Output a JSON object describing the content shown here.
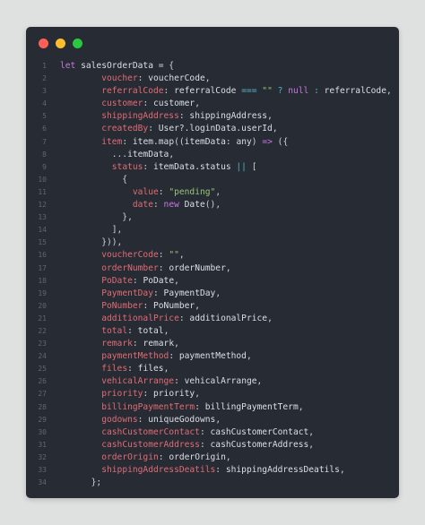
{
  "window": {
    "buttons": [
      {
        "name": "close",
        "color": "#ff5f57"
      },
      {
        "name": "minimize",
        "color": "#febc2e"
      },
      {
        "name": "maximize",
        "color": "#28c840"
      }
    ]
  },
  "code": {
    "lines": [
      {
        "n": "1",
        "t": [
          [
            "kw",
            "let "
          ],
          [
            "id",
            "salesOrderData"
          ],
          [
            "pun",
            " = {"
          ]
        ]
      },
      {
        "n": "2",
        "t": [
          [
            "pun",
            "        "
          ],
          [
            "prop",
            "voucher"
          ],
          [
            "pun",
            ": "
          ],
          [
            "id",
            "voucherCode"
          ],
          [
            "pun",
            ","
          ]
        ]
      },
      {
        "n": "3",
        "t": [
          [
            "pun",
            "        "
          ],
          [
            "prop",
            "referralCode"
          ],
          [
            "pun",
            ": "
          ],
          [
            "id",
            "referralCode "
          ],
          [
            "op",
            "==="
          ],
          [
            "pun",
            " "
          ],
          [
            "str",
            "\"\""
          ],
          [
            "pun",
            " "
          ],
          [
            "op",
            "?"
          ],
          [
            "pun",
            " "
          ],
          [
            "kw",
            "null"
          ],
          [
            "pun",
            " "
          ],
          [
            "op",
            ":"
          ],
          [
            "pun",
            " "
          ],
          [
            "id",
            "referralCode"
          ],
          [
            "pun",
            ","
          ]
        ]
      },
      {
        "n": "4",
        "t": [
          [
            "pun",
            "        "
          ],
          [
            "prop",
            "customer"
          ],
          [
            "pun",
            ": "
          ],
          [
            "id",
            "customer"
          ],
          [
            "pun",
            ","
          ]
        ]
      },
      {
        "n": "5",
        "t": [
          [
            "pun",
            "        "
          ],
          [
            "prop",
            "shippingAddress"
          ],
          [
            "pun",
            ": "
          ],
          [
            "id",
            "shippingAddress"
          ],
          [
            "pun",
            ","
          ]
        ]
      },
      {
        "n": "6",
        "t": [
          [
            "pun",
            "        "
          ],
          [
            "prop",
            "createdBy"
          ],
          [
            "pun",
            ": "
          ],
          [
            "id",
            "User?.loginData.userId"
          ],
          [
            "pun",
            ","
          ]
        ]
      },
      {
        "n": "7",
        "t": [
          [
            "pun",
            "        "
          ],
          [
            "prop",
            "item"
          ],
          [
            "pun",
            ": "
          ],
          [
            "id",
            "item.map"
          ],
          [
            "pun",
            "(("
          ],
          [
            "id",
            "itemData"
          ],
          [
            "pun",
            ": "
          ],
          [
            "id",
            "any"
          ],
          [
            "pun",
            ") "
          ],
          [
            "kw",
            "=>"
          ],
          [
            "pun",
            " ({"
          ]
        ]
      },
      {
        "n": "8",
        "t": [
          [
            "pun",
            "          ..."
          ],
          [
            "id",
            "itemData"
          ],
          [
            "pun",
            ","
          ]
        ]
      },
      {
        "n": "9",
        "t": [
          [
            "pun",
            "          "
          ],
          [
            "prop",
            "status"
          ],
          [
            "pun",
            ": "
          ],
          [
            "id",
            "itemData.status "
          ],
          [
            "op",
            "||"
          ],
          [
            "pun",
            " ["
          ]
        ]
      },
      {
        "n": "10",
        "t": [
          [
            "pun",
            "            {"
          ]
        ]
      },
      {
        "n": "11",
        "t": [
          [
            "pun",
            "              "
          ],
          [
            "prop",
            "value"
          ],
          [
            "pun",
            ": "
          ],
          [
            "str",
            "\"pending\""
          ],
          [
            "pun",
            ","
          ]
        ]
      },
      {
        "n": "12",
        "t": [
          [
            "pun",
            "              "
          ],
          [
            "prop",
            "date"
          ],
          [
            "pun",
            ": "
          ],
          [
            "kw",
            "new "
          ],
          [
            "id",
            "Date"
          ],
          [
            "pun",
            "(),"
          ]
        ]
      },
      {
        "n": "13",
        "t": [
          [
            "pun",
            "            },"
          ]
        ]
      },
      {
        "n": "14",
        "t": [
          [
            "pun",
            "          ],"
          ]
        ]
      },
      {
        "n": "15",
        "t": [
          [
            "pun",
            "        })),"
          ]
        ]
      },
      {
        "n": "16",
        "t": [
          [
            "pun",
            "        "
          ],
          [
            "prop",
            "voucherCode"
          ],
          [
            "pun",
            ": "
          ],
          [
            "str",
            "\"\""
          ],
          [
            "pun",
            ","
          ]
        ]
      },
      {
        "n": "17",
        "t": [
          [
            "pun",
            "        "
          ],
          [
            "prop",
            "orderNumber"
          ],
          [
            "pun",
            ": "
          ],
          [
            "id",
            "orderNumber"
          ],
          [
            "pun",
            ","
          ]
        ]
      },
      {
        "n": "18",
        "t": [
          [
            "pun",
            "        "
          ],
          [
            "prop",
            "PoDate"
          ],
          [
            "pun",
            ": "
          ],
          [
            "id",
            "PoDate"
          ],
          [
            "pun",
            ","
          ]
        ]
      },
      {
        "n": "19",
        "t": [
          [
            "pun",
            "        "
          ],
          [
            "prop",
            "PaymentDay"
          ],
          [
            "pun",
            ": "
          ],
          [
            "id",
            "PaymentDay"
          ],
          [
            "pun",
            ","
          ]
        ]
      },
      {
        "n": "20",
        "t": [
          [
            "pun",
            "        "
          ],
          [
            "prop",
            "PoNumber"
          ],
          [
            "pun",
            ": "
          ],
          [
            "id",
            "PoNumber"
          ],
          [
            "pun",
            ","
          ]
        ]
      },
      {
        "n": "21",
        "t": [
          [
            "pun",
            "        "
          ],
          [
            "prop",
            "additionalPrice"
          ],
          [
            "pun",
            ": "
          ],
          [
            "id",
            "additionalPrice"
          ],
          [
            "pun",
            ","
          ]
        ]
      },
      {
        "n": "22",
        "t": [
          [
            "pun",
            "        "
          ],
          [
            "prop",
            "total"
          ],
          [
            "pun",
            ": "
          ],
          [
            "id",
            "total"
          ],
          [
            "pun",
            ","
          ]
        ]
      },
      {
        "n": "23",
        "t": [
          [
            "pun",
            "        "
          ],
          [
            "prop",
            "remark"
          ],
          [
            "pun",
            ": "
          ],
          [
            "id",
            "remark"
          ],
          [
            "pun",
            ","
          ]
        ]
      },
      {
        "n": "24",
        "t": [
          [
            "pun",
            "        "
          ],
          [
            "prop",
            "paymentMethod"
          ],
          [
            "pun",
            ": "
          ],
          [
            "id",
            "paymentMethod"
          ],
          [
            "pun",
            ","
          ]
        ]
      },
      {
        "n": "25",
        "t": [
          [
            "pun",
            "        "
          ],
          [
            "prop",
            "files"
          ],
          [
            "pun",
            ": "
          ],
          [
            "id",
            "files"
          ],
          [
            "pun",
            ","
          ]
        ]
      },
      {
        "n": "26",
        "t": [
          [
            "pun",
            "        "
          ],
          [
            "prop",
            "vehicalArrange"
          ],
          [
            "pun",
            ": "
          ],
          [
            "id",
            "vehicalArrange"
          ],
          [
            "pun",
            ","
          ]
        ]
      },
      {
        "n": "27",
        "t": [
          [
            "pun",
            "        "
          ],
          [
            "prop",
            "priority"
          ],
          [
            "pun",
            ": "
          ],
          [
            "id",
            "priority"
          ],
          [
            "pun",
            ","
          ]
        ]
      },
      {
        "n": "28",
        "t": [
          [
            "pun",
            "        "
          ],
          [
            "prop",
            "billingPaymentTerm"
          ],
          [
            "pun",
            ": "
          ],
          [
            "id",
            "billingPaymentTerm"
          ],
          [
            "pun",
            ","
          ]
        ]
      },
      {
        "n": "29",
        "t": [
          [
            "pun",
            "        "
          ],
          [
            "prop",
            "godowns"
          ],
          [
            "pun",
            ": "
          ],
          [
            "id",
            "uniqueGodowns"
          ],
          [
            "pun",
            ","
          ]
        ]
      },
      {
        "n": "30",
        "t": [
          [
            "pun",
            "        "
          ],
          [
            "prop",
            "cashCustomerContact"
          ],
          [
            "pun",
            ": "
          ],
          [
            "id",
            "cashCustomerContact"
          ],
          [
            "pun",
            ","
          ]
        ]
      },
      {
        "n": "31",
        "t": [
          [
            "pun",
            "        "
          ],
          [
            "prop",
            "cashCustomerAddress"
          ],
          [
            "pun",
            ": "
          ],
          [
            "id",
            "cashCustomerAddress"
          ],
          [
            "pun",
            ","
          ]
        ]
      },
      {
        "n": "32",
        "t": [
          [
            "pun",
            "        "
          ],
          [
            "prop",
            "orderOrigin"
          ],
          [
            "pun",
            ": "
          ],
          [
            "id",
            "orderOrigin"
          ],
          [
            "pun",
            ","
          ]
        ]
      },
      {
        "n": "33",
        "t": [
          [
            "pun",
            "        "
          ],
          [
            "prop",
            "shippingAddressDeatils"
          ],
          [
            "pun",
            ": "
          ],
          [
            "id",
            "shippingAddressDeatils"
          ],
          [
            "pun",
            ","
          ]
        ]
      },
      {
        "n": "34",
        "t": [
          [
            "pun",
            "      };"
          ]
        ]
      }
    ]
  }
}
